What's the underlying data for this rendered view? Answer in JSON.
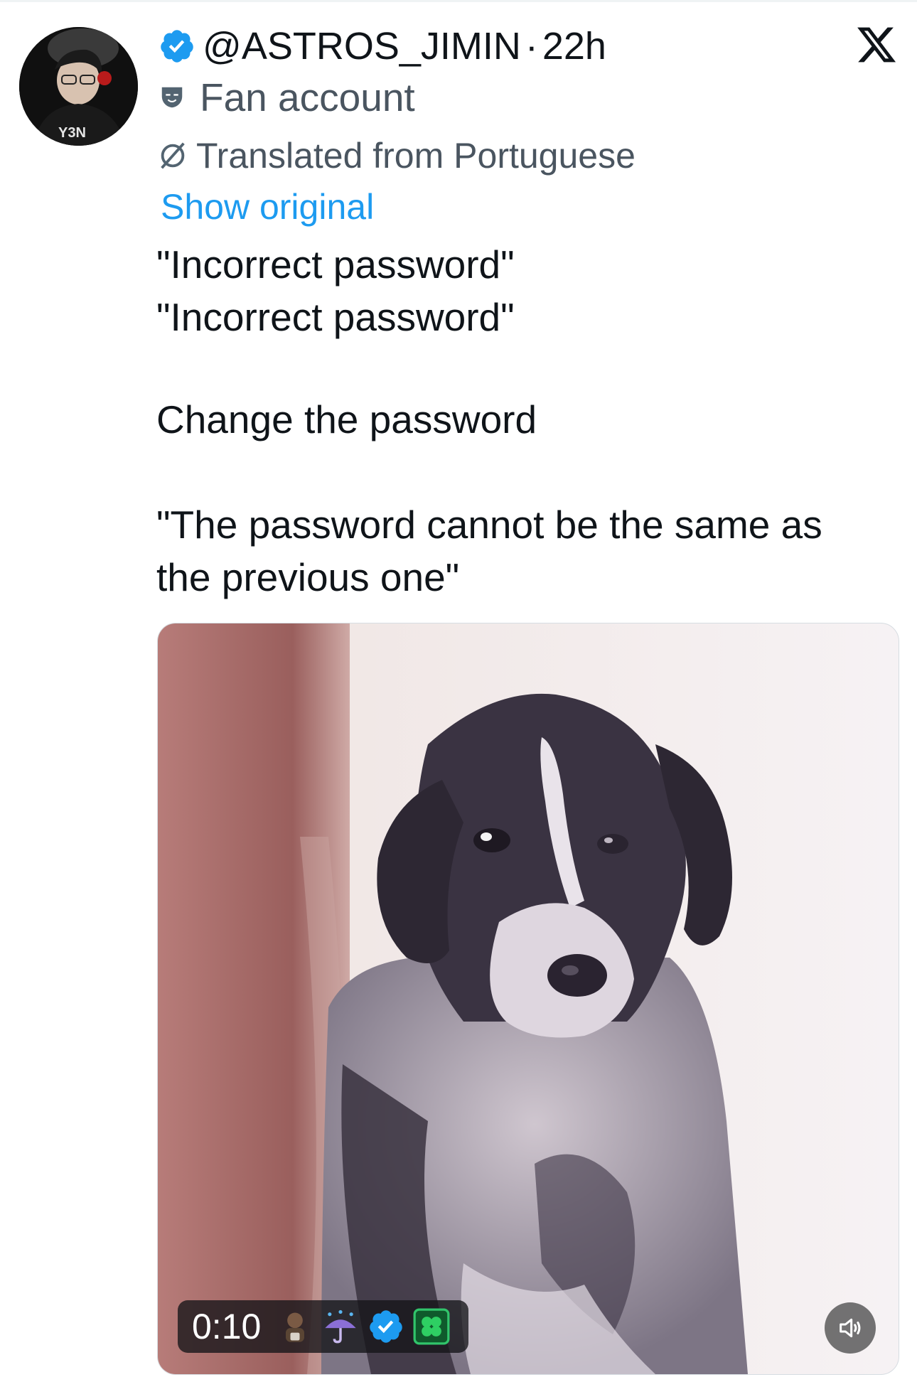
{
  "tweet": {
    "handle": "@ASTROS_JIMIN",
    "separator": "·",
    "time_ago": "22h",
    "account_label": "Fan account",
    "translation_note": "Translated from Portuguese",
    "show_original_label": "Show original",
    "text_lines": [
      "\"Incorrect password\"",
      "\"Incorrect password\"",
      "Change the password",
      "\"The password cannot be the same as the previous one\""
    ]
  },
  "video": {
    "duration": "0:10",
    "overlay_icons": [
      "person-icon",
      "umbrella-rain-icon",
      "verified-icon",
      "clover-icon"
    ]
  },
  "colors": {
    "link": "#1d9bf0",
    "verified": "#1d9bf0",
    "secondary_text": "#4a5560",
    "primary_text": "#0f1419"
  },
  "icons": {
    "brand": "x-logo-icon",
    "avatar": "avatar",
    "volume": "speaker-icon"
  }
}
